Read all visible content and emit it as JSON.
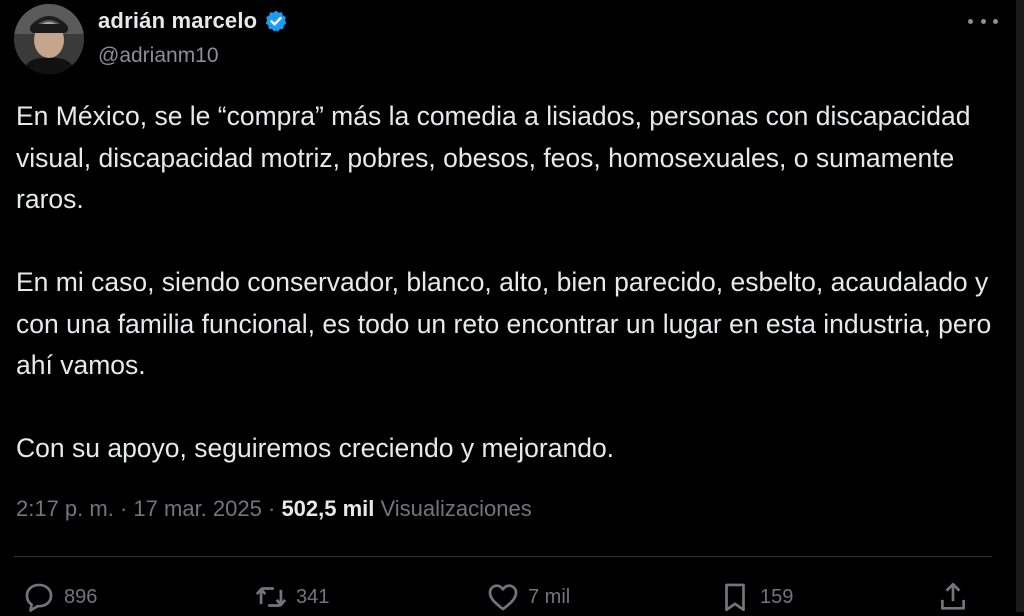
{
  "author": {
    "display_name": "adrián marcelo",
    "handle": "@adrianm10",
    "verified": true
  },
  "tweet": {
    "paragraphs": [
      "En México, se le “compra” más la comedia a lisiados, personas con discapacidad visual, discapacidad motriz, pobres, obesos, feos, homosexuales, o sumamente raros.",
      "En mi caso, siendo conservador, blanco, alto, bien parecido, esbelto, acaudalado y con una familia funcional, es todo un reto encontrar un lugar en esta industria, pero ahí vamos.",
      "Con su apoyo, seguiremos creciendo y mejorando."
    ]
  },
  "meta": {
    "time": "2:17 p. m.",
    "separator": "·",
    "date": "17 mar. 2025",
    "views_count": "502,5 mil",
    "views_label": "Visualizaciones"
  },
  "actions": {
    "replies": "896",
    "reposts": "341",
    "likes": "7 mil",
    "bookmarks": "159"
  },
  "colors": {
    "background": "#000000",
    "text": "#e7e9ea",
    "muted": "#71767b",
    "verified_blue": "#1d9bf0"
  },
  "icons": [
    "more-icon",
    "verified-icon",
    "reply-icon",
    "repost-icon",
    "like-icon",
    "bookmark-icon",
    "share-icon"
  ]
}
